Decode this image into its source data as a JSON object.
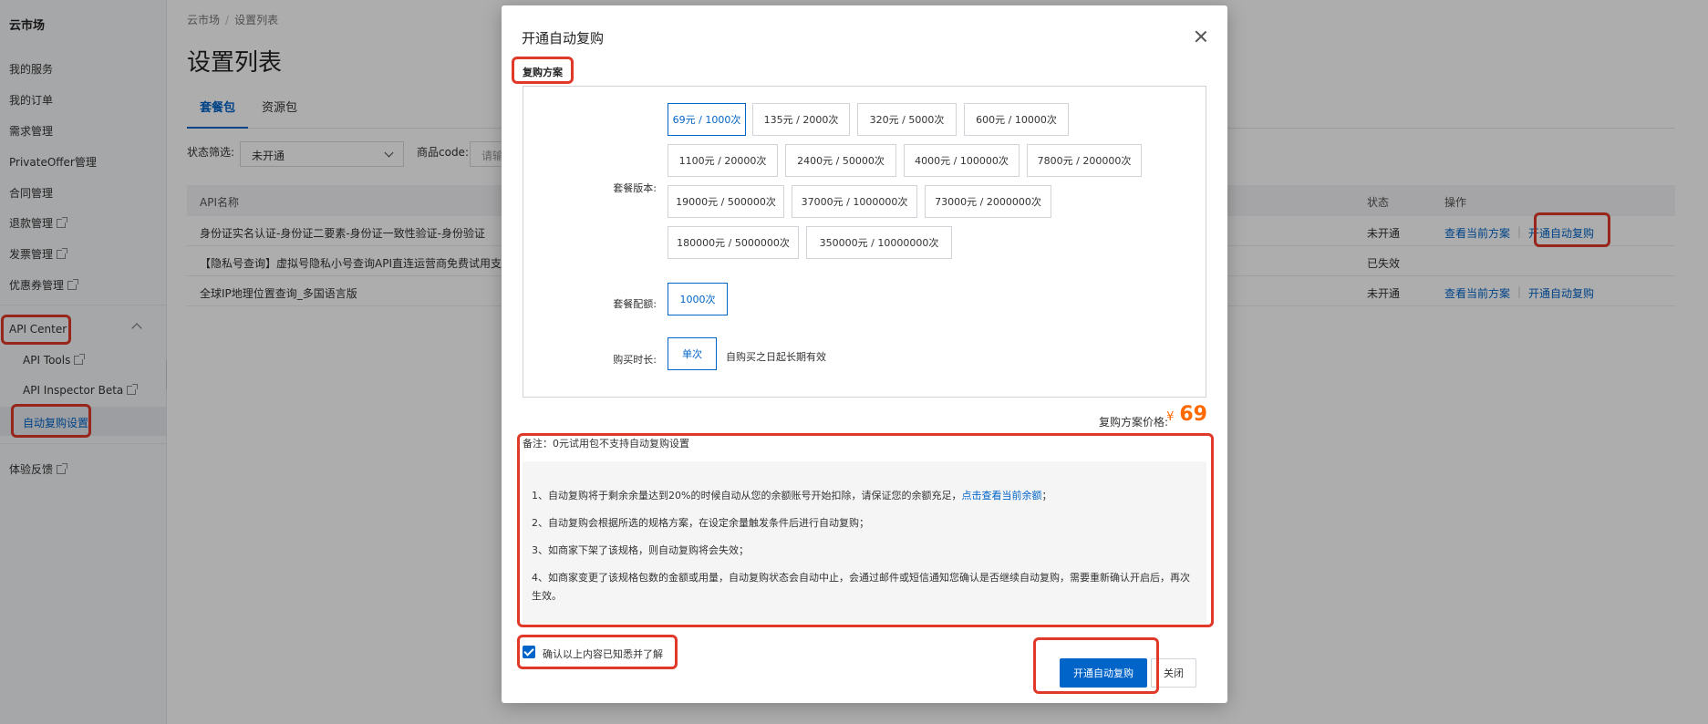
{
  "sidebar": {
    "brand": "云市场",
    "items": [
      {
        "label": "我的服务"
      },
      {
        "label": "我的订单"
      },
      {
        "label": "需求管理"
      },
      {
        "label": "PrivateOffer管理"
      },
      {
        "label": "合同管理"
      },
      {
        "label": "退款管理"
      },
      {
        "label": "发票管理"
      },
      {
        "label": "优惠券管理"
      }
    ],
    "group_label": "API Center",
    "sub_items": [
      {
        "label": "API Tools"
      },
      {
        "label": "API Inspector Beta"
      },
      {
        "label": "自动复购设置"
      }
    ],
    "feedback": "体验反馈"
  },
  "breadcrumb": {
    "root": "云市场",
    "separator": "/",
    "current": "设置列表"
  },
  "page_title": "设置列表",
  "tabs": [
    {
      "label": "套餐包"
    },
    {
      "label": "资源包"
    }
  ],
  "filters": {
    "status_label": "状态筛选:",
    "status_value": "未开通",
    "code_label": "商品code:",
    "code_placeholder": "请输"
  },
  "table": {
    "headers": {
      "name": "API名称",
      "status": "状态",
      "ops": "操作"
    },
    "rows": [
      {
        "name": "身份证实名认证-身份证二要素-身份证一致性验证-身份验证",
        "status": "未开通",
        "op1": "查看当前方案",
        "op2": "开通自动复购"
      },
      {
        "name": "【隐私号查询】虚拟号隐私小号查询API直连运营商免费试用支持问",
        "status": "已失效",
        "op1": "",
        "op2": ""
      },
      {
        "name": "全球IP地理位置查询_多国语言版",
        "status": "未开通",
        "op1": "查看当前方案",
        "op2": "开通自动复购"
      }
    ],
    "op_divider": "|"
  },
  "modal": {
    "title": "开通自动复购",
    "section_label": "复购方案",
    "version_label": "套餐版本:",
    "versions": [
      {
        "label": "69元 / 1000次",
        "selected": true
      },
      {
        "label": "135元 / 2000次",
        "selected": false
      },
      {
        "label": "320元 / 5000次",
        "selected": false
      },
      {
        "label": "600元 / 10000次",
        "selected": false
      },
      {
        "label": "1100元 / 20000次",
        "selected": false
      },
      {
        "label": "2400元 / 50000次",
        "selected": false
      },
      {
        "label": "4000元 / 100000次",
        "selected": false
      },
      {
        "label": "7800元 / 200000次",
        "selected": false
      },
      {
        "label": "19000元 / 500000次",
        "selected": false
      },
      {
        "label": "37000元 / 1000000次",
        "selected": false
      },
      {
        "label": "73000元 / 2000000次",
        "selected": false
      },
      {
        "label": "180000元 / 5000000次",
        "selected": false
      },
      {
        "label": "350000元 / 10000000次",
        "selected": false
      }
    ],
    "quota_label": "套餐配额:",
    "quota_value": "1000次",
    "duration_label": "购买时长:",
    "duration_value": "单次",
    "duration_note": "自购买之日起长期有效",
    "price_label": "复购方案价格:",
    "price_currency": "¥",
    "price_value": "69",
    "remark": "备注：0元试用包不支持自动复购设置",
    "notice": {
      "line1_pre": "1、自动复购将于剩余余量达到20%的时候自动从您的余额账号开始扣除，请保证您的余额充足，",
      "line1_link": "点击查看当前余额",
      "line1_post": "；",
      "line2": "2、自动复购会根据所选的规格方案，在设定余量触发条件后进行自动复购；",
      "line3": "3、如商家下架了该规格，则自动复购将会失效；",
      "line4": "4、如商家变更了该规格包数的金额或用量，自动复购状态会自动中止，会通过邮件或短信通知您确认是否继续自动复购，需要重新确认开启后，再次生效。"
    },
    "confirm_label": "确认以上内容已知悉并了解",
    "confirm_checked": true,
    "submit_label": "开通自动复购",
    "close_label": "关闭"
  },
  "colors": {
    "accent": "#0064c8",
    "price": "#ff6a00",
    "highlight": "#e0392a"
  }
}
